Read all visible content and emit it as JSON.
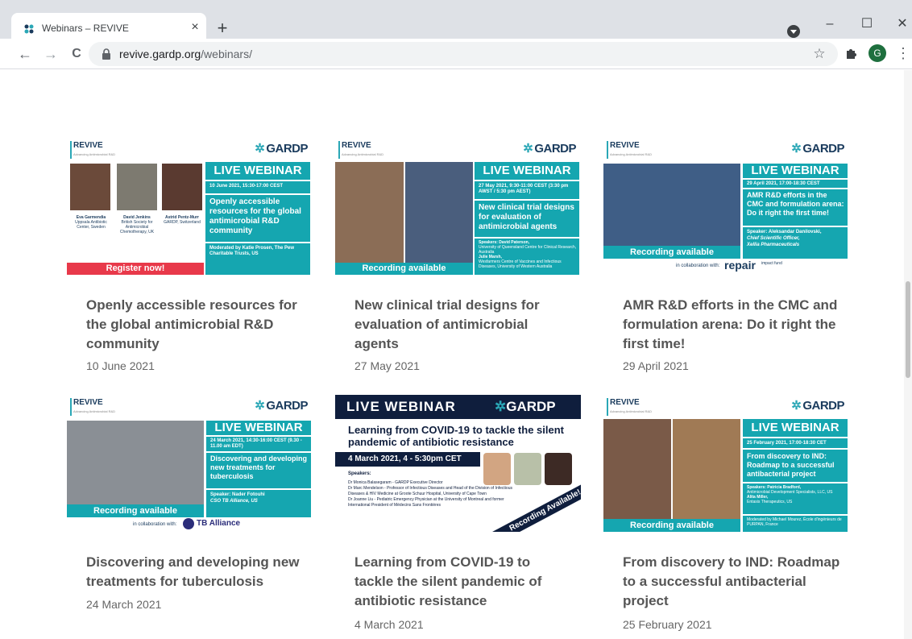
{
  "browser": {
    "tab_title": "Webinars – REVIVE",
    "tab_close": "×",
    "new_tab": "+",
    "url_host": "revive.gardp.org",
    "url_path": "/webinars/",
    "avatar_letter": "G",
    "window_min": "–",
    "window_max": "☐",
    "window_close": "✕"
  },
  "nav": {
    "back": "←",
    "forward": "→",
    "reload": "C"
  },
  "cards": [
    {
      "title": "Openly accessible resources for the global antimicrobial R&D community",
      "date": "10 June 2021",
      "thumb": {
        "banner": "LIVE WEBINAR",
        "when": "10 June 2021, 15:30-17:00 CEST",
        "topic": "Openly accessible resources for the global antimicrobial R&D community",
        "moderator": "Moderated by Katie Prosen, The Pew Charitable Trusts, US",
        "cta": "Register now!",
        "speaker1": "Eva Garmendia",
        "speaker1_org": "Uppsala Antibiotic Center, Sweden",
        "speaker2": "David Jenkins",
        "speaker2_org": "British Society for Antimicrobial Chemotherapy, UK",
        "speaker3": "Astrid Pentz-Murr",
        "speaker3_org": "GARDP, Switzerland"
      }
    },
    {
      "title": "New clinical trial designs for evaluation of antimicrobial agents",
      "date": "27 May 2021",
      "thumb": {
        "banner": "LIVE WEBINAR",
        "when": "27 May 2021, 9:30-11:00 CEST (3:30 pm AWST / 5:30 pm AEST)",
        "topic": "New clinical trial designs for evaluation of antimicrobial agents",
        "speakers_label": "Speakers:",
        "speaker1": "David Paterson,",
        "speaker1_org": "University of Queensland Centre for Clinical Research, Australia",
        "speaker2": "Julie Marsh,",
        "speaker2_org": "Wesfarmers Centre of Vaccines and Infectious Diseases, University of Western Australia",
        "cta": "Recording available"
      }
    },
    {
      "title": "AMR R&D efforts in the CMC and formulation arena: Do it right the first time!",
      "date": "29 April 2021",
      "thumb": {
        "banner": "LIVE WEBINAR",
        "when": "29 April 2021, 17:00-18:30 CEST",
        "topic": "AMR R&D efforts in the CMC and formulation arena: Do it right the first time!",
        "speaker_label": "Speaker:",
        "speaker": "Aleksandar Danilovski,",
        "speaker_role": "Chief Scientific Officer,",
        "speaker_org": "Xellia Pharmaceuticals",
        "cta": "Recording available",
        "collab": "in collaboration with:",
        "collab_logo": "repair",
        "collab_logo_sub": "impact fund"
      }
    },
    {
      "title": "Discovering and developing new treatments for tuberculosis",
      "date": "24 March 2021",
      "thumb": {
        "banner": "LIVE WEBINAR",
        "when": "24 March 2021, 14:30-16:00 CEST (9.30 - 11.00 am EDT)",
        "topic": "Discovering and developing new treatments for tuberculosis",
        "speaker_label": "Speaker:",
        "speaker": "Nader Fotouhi",
        "speaker_org": "CSO TB Alliance, US",
        "cta": "Recording available",
        "collab": "in collaboration with:",
        "collab_logo": "TB Alliance"
      }
    },
    {
      "title": "Learning from COVID-19 to tackle the silent pandemic of antibiotic resistance",
      "date": "4 March 2021",
      "thumb": {
        "banner": "LIVE WEBINAR",
        "headline": "Learning from COVID-19 to tackle the silent pandemic of antibiotic resistance",
        "when": "4 March 2021, 4 - 5:30pm CET",
        "speakers_label": "Speakers:",
        "speaker1": "Dr Monica Balasegaram - GARDP Executive Director",
        "speaker2": "Dr Marc Mendelson - Professor of Infectious Diseases and Head of the Division of Infectious Diseases & HIV Medicine at Groote Schuur Hospital, University of Cape Town",
        "speaker3": "Dr Joanne Liu - Pediatric Emergency Physician at the University of Montreal and former International President of Médecins Sans Frontières",
        "cta": "Recording Available!"
      }
    },
    {
      "title": "From discovery to IND: Roadmap to a successful antibacterial project",
      "date": "25 February 2021",
      "thumb": {
        "banner": "LIVE WEBINAR",
        "when": "25 February 2021, 17:00-18:30 CET",
        "topic": "From discovery to IND: Roadmap to a successful antibacterial project",
        "speakers_label": "Speakers:",
        "speaker1": "Patricia Bradford,",
        "speaker1_org": "Antimicrobial Development Specialists, LLC, US",
        "speaker2": "Alita Miller,",
        "speaker2_org": "Entasis Therapeutics, US",
        "moderator": "Moderated by Michael Mourez, École d'ingénieurs de PURPAN, France",
        "cta": "Recording available"
      }
    }
  ],
  "common": {
    "revive": "REVIVE",
    "revive_sub": "Advancing Antimicrobial R&D",
    "gardp": "GARDP"
  },
  "colors": {
    "teal": "#15a6b0",
    "red": "#e8394a",
    "navy": "#1a3b5d"
  }
}
